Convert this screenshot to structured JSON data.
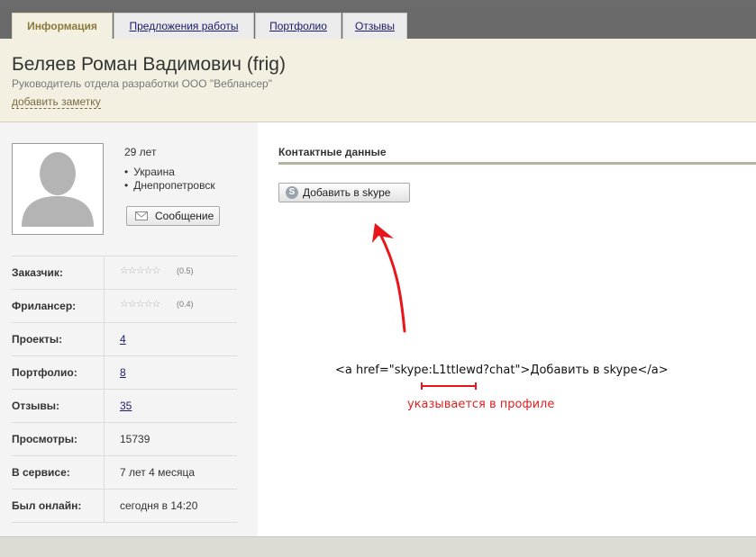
{
  "tabs": [
    {
      "label": "Информация",
      "active": true
    },
    {
      "label": "Предложения работы",
      "active": false
    },
    {
      "label": "Портфолио",
      "active": false
    },
    {
      "label": "Отзывы",
      "active": false
    }
  ],
  "profile": {
    "name": "Беляев Роман Вадимович (frig)",
    "subtitle": "Руководитель отдела разработки ООО \"Веблансер\"",
    "add_note": "добавить заметку",
    "age": "29 лет",
    "country": "Украина",
    "city": "Днепропетровск",
    "message_button": "Сообщение"
  },
  "stats": [
    {
      "label": "Заказчик:",
      "stars": "☆☆☆☆☆",
      "rating": "(0.5)"
    },
    {
      "label": "Фрилансер:",
      "stars": "☆☆☆☆☆",
      "rating": "(0.4)"
    },
    {
      "label": "Проекты:",
      "value": "4"
    },
    {
      "label": "Портфолио:",
      "value": "8"
    },
    {
      "label": "Отзывы:",
      "value": "35"
    },
    {
      "label": "Просмотры:",
      "value": "15739"
    },
    {
      "label": "В сервисе:",
      "value": "7 лет 4 месяца"
    },
    {
      "label": "Был онлайн:",
      "value": "сегодня в 14:20"
    }
  ],
  "contacts": {
    "title": "Контактные данные",
    "skype_button": "Добавить в skype"
  },
  "annotation": {
    "code": "<a href=\"skype:L1ttlewd?chat\">Добавить в skype</a>",
    "note": "указывается в профиле",
    "color": "#e02020"
  },
  "icons": {
    "envelope": "envelope-icon",
    "skype": "skype-icon",
    "avatar": "user-silhouette-icon",
    "star": "star-icon"
  }
}
